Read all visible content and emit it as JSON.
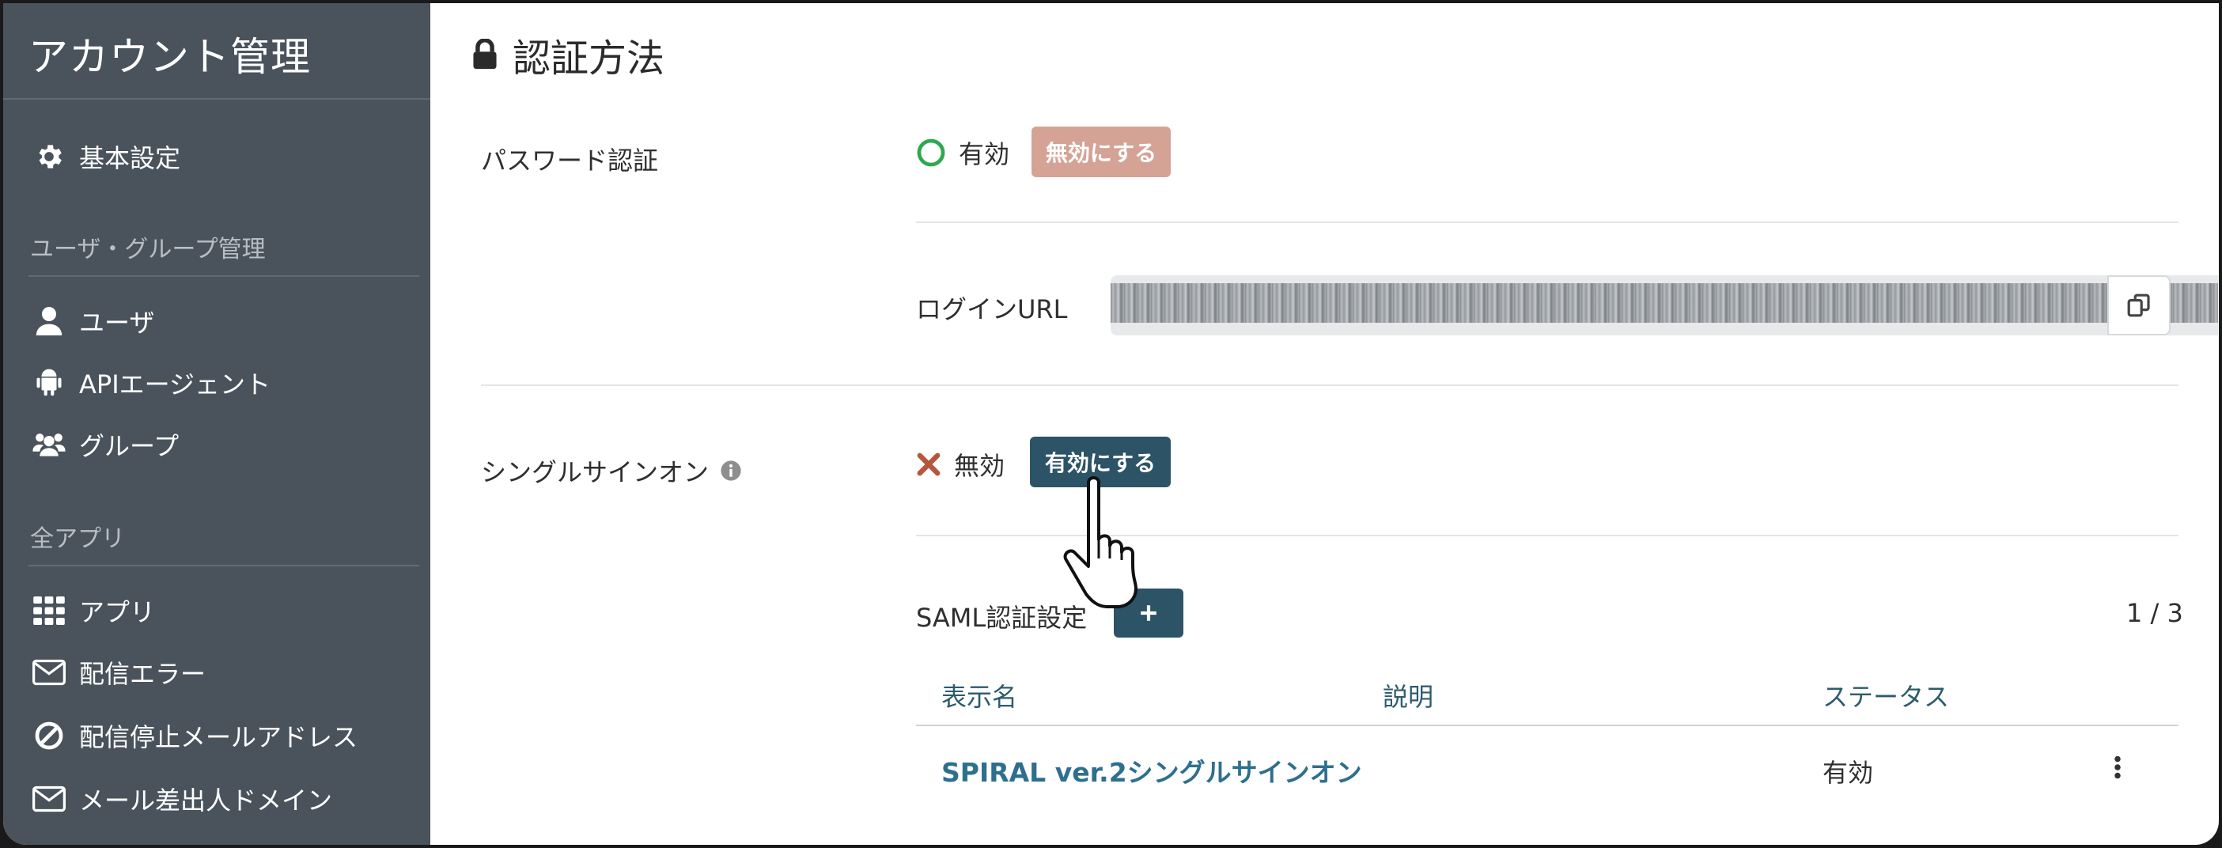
{
  "sidebar": {
    "title": "アカウント管理",
    "items": [
      {
        "label": "基本設定",
        "icon": "gear-icon"
      },
      {
        "label": "ユーザ",
        "icon": "user-icon"
      },
      {
        "label": "APIエージェント",
        "icon": "android-icon"
      },
      {
        "label": "グループ",
        "icon": "users-icon"
      },
      {
        "label": "アプリ",
        "icon": "grid-icon"
      },
      {
        "label": "配信エラー",
        "icon": "envelope-icon"
      },
      {
        "label": "配信停止メールアドレス",
        "icon": "ban-icon"
      },
      {
        "label": "メール差出人ドメイン",
        "icon": "envelope-icon"
      }
    ],
    "sections": [
      "ユーザ・グループ管理",
      "全アプリ"
    ]
  },
  "page": {
    "title": "認証方法",
    "title_icon": "lock-icon"
  },
  "password_auth": {
    "label": "パスワード認証",
    "status": "有効",
    "status_color": "#2fa84f",
    "button": "無効にする",
    "button_color": "#d4a396",
    "login_url_label": "ログインURL"
  },
  "sso": {
    "label": "シングルサインオン",
    "status": "無効",
    "status_color": "#b5573e",
    "button": "有効にする",
    "button_color": "#2c5366"
  },
  "saml": {
    "label": "SAML認証設定",
    "counter": "1 / 3",
    "columns": [
      "表示名",
      "説明",
      "ステータス"
    ],
    "rows": [
      {
        "name": "SPIRAL ver.2シングルサインオン",
        "description": "",
        "status": "有効"
      }
    ]
  }
}
